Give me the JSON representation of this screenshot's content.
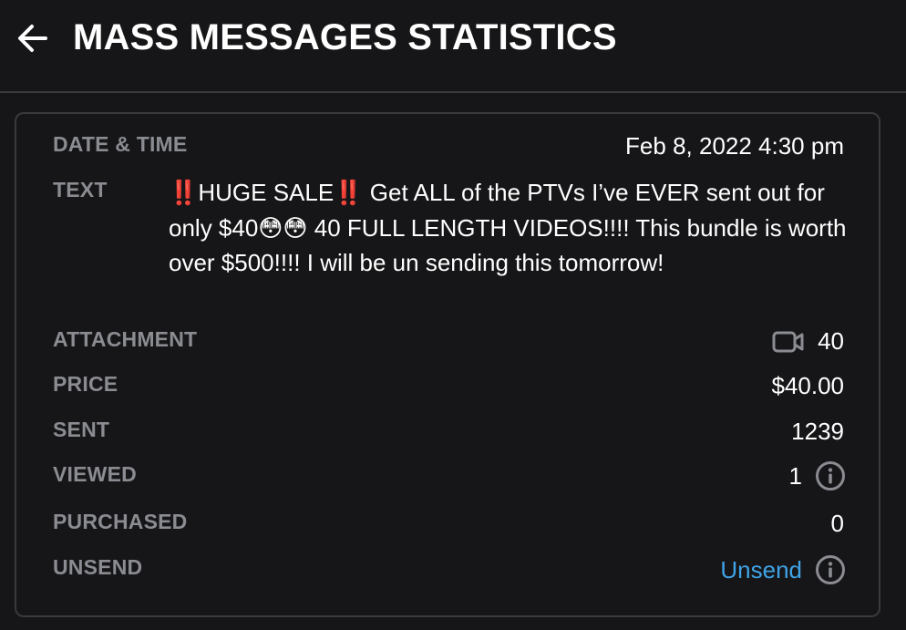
{
  "header": {
    "back_icon": "arrow-left-icon",
    "title": "MASS MESSAGES STATISTICS"
  },
  "stats": {
    "date_time_label": "DATE & TIME",
    "date_time_value": "Feb 8, 2022 4:30 pm",
    "text_label": "TEXT",
    "text_value": "‼️HUGE SALE‼️ Get ALL of the PTVs I’ve EVER sent out for only $40😳😳 40 FULL LENGTH VIDEOS!!!! This bundle is worth over $500!!!! I will be un sending this tomorrow!",
    "attachment_label": "ATTACHMENT",
    "attachment_icon": "video-camera-icon",
    "attachment_value": "40",
    "price_label": "PRICE",
    "price_value": "$40.00",
    "sent_label": "SENT",
    "sent_value": "1239",
    "viewed_label": "VIEWED",
    "viewed_value": "1",
    "purchased_label": "PURCHASED",
    "purchased_value": "0",
    "unsend_label": "UNSEND",
    "unsend_link": "Unsend",
    "info_icon": "info-icon"
  },
  "colors": {
    "background": "#161618",
    "label": "#8a8c91",
    "link": "#3fa3e6",
    "border": "#3a3a3d"
  }
}
